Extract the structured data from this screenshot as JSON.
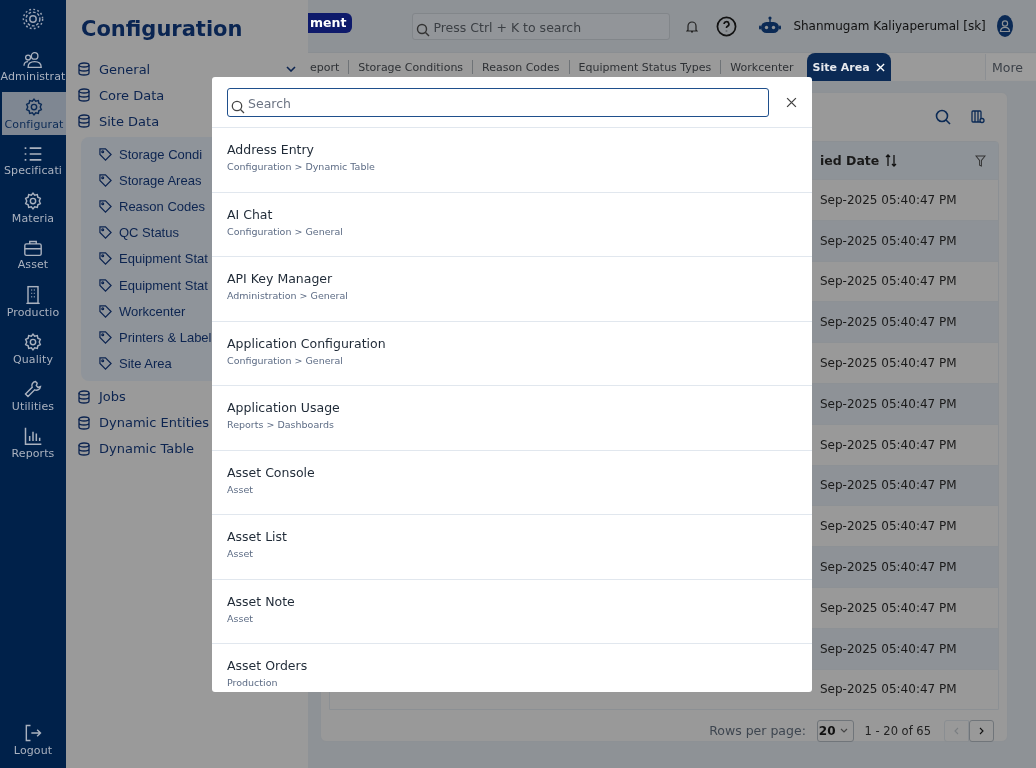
{
  "nav_rail": {
    "items": [
      {
        "label": "Administrat",
        "selected": false
      },
      {
        "label": "Configurat",
        "selected": true
      },
      {
        "label": "Specificati",
        "selected": false
      },
      {
        "label": "Materia",
        "selected": false
      },
      {
        "label": "Asset",
        "selected": false
      },
      {
        "label": "Productio",
        "selected": false
      },
      {
        "label": "Quality",
        "selected": false
      },
      {
        "label": "Utilities",
        "selected": false
      },
      {
        "label": "Reports",
        "selected": false
      }
    ],
    "logout": "Logout"
  },
  "config_panel": {
    "title": "Configuration",
    "items": [
      {
        "label": "General",
        "chevron": true
      },
      {
        "label": "Core Data",
        "chevron": false
      },
      {
        "label": "Site Data",
        "chevron": false,
        "children": [
          "Storage Condi",
          "Storage Areas",
          "Reason Codes",
          "QC Status",
          "Equipment Stat",
          "Equipment Stat",
          "Workcenter",
          "Printers & Label",
          "Site Area"
        ]
      },
      {
        "label": "Jobs",
        "chevron": false
      },
      {
        "label": "Dynamic Entities",
        "chevron": false
      },
      {
        "label": "Dynamic Table",
        "chevron": false
      }
    ]
  },
  "topbar": {
    "module_badge": "ment",
    "search": {
      "placeholder": "Press Ctrl + K to search"
    },
    "user": "Shanmugam Kaliyaperumal [sk]"
  },
  "tabs": [
    {
      "label": "eport",
      "selected": false
    },
    {
      "label": "Storage Conditions",
      "selected": false
    },
    {
      "label": "Reason Codes",
      "selected": false
    },
    {
      "label": "Equipment Status Types",
      "selected": false
    },
    {
      "label": "Workcenter",
      "selected": false
    },
    {
      "label": "Site Area",
      "selected": true
    }
  ],
  "more_button": "More",
  "table": {
    "columns": [
      "ied Date"
    ],
    "rows": [
      "Sep-2025 05:40:47 PM",
      "Sep-2025 05:40:47 PM",
      "Sep-2025 05:40:47 PM",
      "Sep-2025 05:40:47 PM",
      "Sep-2025 05:40:47 PM",
      "Sep-2025 05:40:47 PM",
      "Sep-2025 05:40:47 PM",
      "Sep-2025 05:40:47 PM",
      "Sep-2025 05:40:47 PM",
      "Sep-2025 05:40:47 PM",
      "Sep-2025 05:40:47 PM",
      "Sep-2025 05:40:47 PM",
      "Sep-2025 05:40:47 PM"
    ]
  },
  "pagination": {
    "rows_per_page_label": "Rows per page:",
    "rows_per_page": "20",
    "range": "1 - 20 of 65",
    "prev_disabled": true,
    "next_disabled": false
  },
  "search_dialog": {
    "search": {
      "placeholder": "Search"
    },
    "results": [
      {
        "title": "Address Entry",
        "path": "Configuration > Dynamic Table"
      },
      {
        "title": "AI Chat",
        "path": "Configuration > General"
      },
      {
        "title": "API Key Manager",
        "path": "Administration > General"
      },
      {
        "title": "Application Configuration",
        "path": "Configuration > General"
      },
      {
        "title": "Application Usage",
        "path": "Reports > Dashboards"
      },
      {
        "title": "Asset Console",
        "path": "Asset"
      },
      {
        "title": "Asset List",
        "path": "Asset"
      },
      {
        "title": "Asset Note",
        "path": "Asset"
      },
      {
        "title": "Asset Orders",
        "path": "Production"
      }
    ]
  }
}
